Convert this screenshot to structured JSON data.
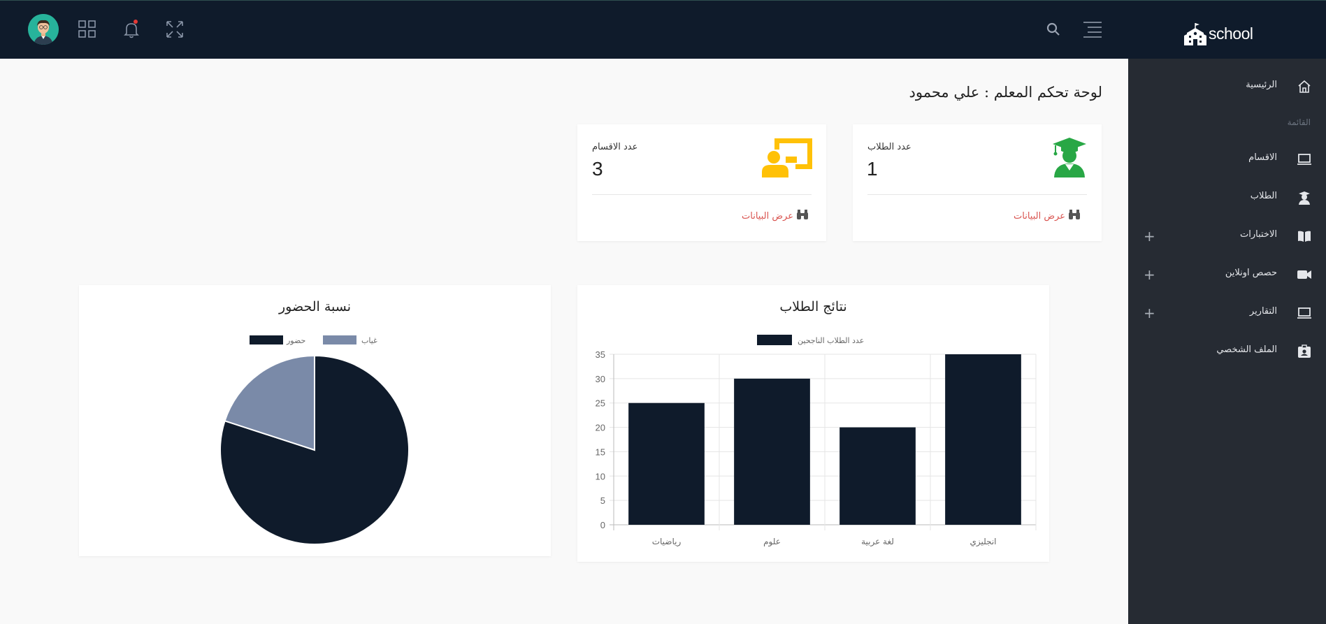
{
  "header": {
    "brand": "school",
    "icons": [
      "avatar",
      "apps-grid-icon",
      "bell-icon",
      "fullscreen-icon",
      "search-icon",
      "menu-toggle-icon"
    ],
    "colors": {
      "topbar": "#0f1b2b",
      "notification_dot": "#e53935"
    }
  },
  "sidebar": {
    "items": [
      {
        "label": "الرئيسية",
        "icon": "home-icon"
      },
      {
        "label": "الاقسام",
        "icon": "monitor-icon"
      },
      {
        "label": "الطلاب",
        "icon": "student-icon"
      },
      {
        "label": "الاختبارات",
        "icon": "book-icon",
        "expandable": "+"
      },
      {
        "label": "حصص اونلاين",
        "icon": "video-icon",
        "expandable": "+"
      },
      {
        "label": "التقارير",
        "icon": "monitor-icon",
        "expandable": "+"
      },
      {
        "label": "الملف الشخصي",
        "icon": "id-card-icon"
      }
    ],
    "menu_heading": "القائمة"
  },
  "main": {
    "page_title": "لوحة تحكم المعلم : علي محمود",
    "stats": [
      {
        "label": "عدد الطلاب",
        "value": "1",
        "link": "عرض البيانات",
        "icon": "graduate-icon",
        "icon_color": "#28a745"
      },
      {
        "label": "عدد الاقسام",
        "value": "3",
        "link": "عرض البيانات",
        "icon": "teacher-board-icon",
        "icon_color": "#ffc107"
      }
    ]
  },
  "charts": {
    "results_title": "نتائج الطلاب",
    "attendance_title": "نسبة الحضور"
  },
  "chart_data": [
    {
      "type": "bar",
      "title": "نتائج الطلاب",
      "categories": [
        "رياضيات",
        "علوم",
        "لغة عربية",
        "انجليزي"
      ],
      "series": [
        {
          "name": "عدد الطلاب الناجحين",
          "values": [
            25,
            30,
            20,
            35
          ],
          "color": "#0f1b2b"
        }
      ],
      "ylim": [
        0,
        35
      ],
      "yticks": [
        0,
        5,
        10,
        15,
        20,
        25,
        30,
        35
      ],
      "grid": true,
      "legend": "top"
    },
    {
      "type": "pie",
      "title": "نسبة الحضور",
      "labels": [
        "حضور",
        "غياب"
      ],
      "values": [
        80,
        20
      ],
      "colors": [
        "#0f1b2b",
        "#7a8aa8"
      ],
      "legend": "top"
    }
  ]
}
